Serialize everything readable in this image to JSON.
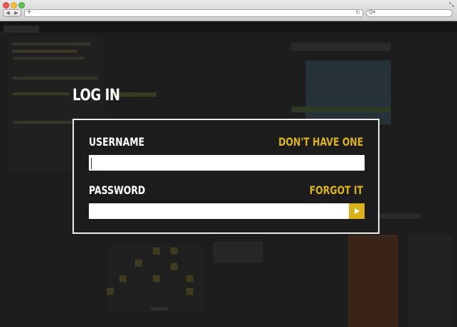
{
  "browser": {
    "back_glyph": "◀",
    "forward_glyph": "▶",
    "new_tab_glyph": "+",
    "reload_glyph": "↻",
    "search_glyph": "Q▾",
    "url": "",
    "search": ""
  },
  "login": {
    "title": "LOG IN",
    "username_label": "USERNAME",
    "username_link": "DON'T HAVE ONE",
    "username_value": "",
    "password_label": "PASSWORD",
    "password_link": "FORGOT IT",
    "password_value": ""
  },
  "colors": {
    "accent": "#d9b21b",
    "panel_bg": "#1c1c1c",
    "panel_border": "#ededed"
  },
  "icons": {
    "submit": "play-arrow-icon"
  }
}
